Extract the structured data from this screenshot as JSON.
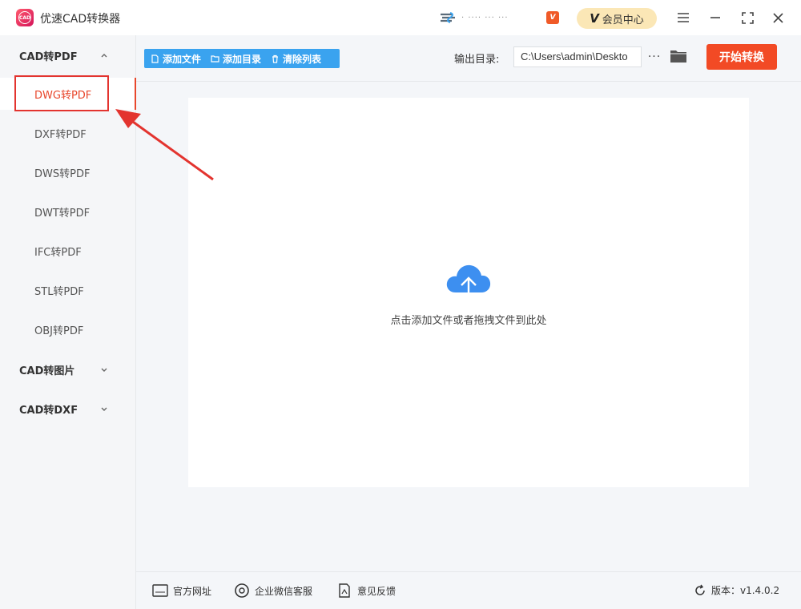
{
  "app": {
    "title": "优速CAD转换器",
    "logo_text": "CAD"
  },
  "titlebar": {
    "user_text": "· ···· ··· ···",
    "vip_small": "V",
    "vip_button_label": "会员中心",
    "vip_button_mark": "V",
    "menu_icon": "≡",
    "minimize_icon": "—",
    "maximize_icon": "⛶",
    "close_icon": "✕"
  },
  "sidebar": {
    "groups": [
      {
        "label": "CAD转PDF",
        "expanded": true,
        "items": [
          {
            "label": "DWG转PDF",
            "active": true
          },
          {
            "label": "DXF转PDF"
          },
          {
            "label": "DWS转PDF"
          },
          {
            "label": "DWT转PDF"
          },
          {
            "label": "IFC转PDF"
          },
          {
            "label": "STL转PDF"
          },
          {
            "label": "OBJ转PDF"
          }
        ]
      },
      {
        "label": "CAD转图片",
        "expanded": false
      },
      {
        "label": "CAD转DXF",
        "expanded": false
      }
    ]
  },
  "toolbar": {
    "add_file": "添加文件",
    "add_dir": "添加目录",
    "clear_list": "清除列表",
    "output_label": "输出目录:",
    "output_path": "C:\\Users\\admin\\Deskto",
    "dots": "···",
    "start_label": "开始转换"
  },
  "dropzone": {
    "hint": "点击添加文件或者拖拽文件到此处"
  },
  "footer": {
    "website": "官方网址",
    "wechat": "企业微信客服",
    "feedback": "意见反馈",
    "version": "版本：v1.4.0.2"
  },
  "colors": {
    "accent": "#f24a25",
    "toolbar_blue": "#3aa3ef",
    "vip_bg": "#fbe7b6",
    "cloud": "#3d8ff0"
  }
}
